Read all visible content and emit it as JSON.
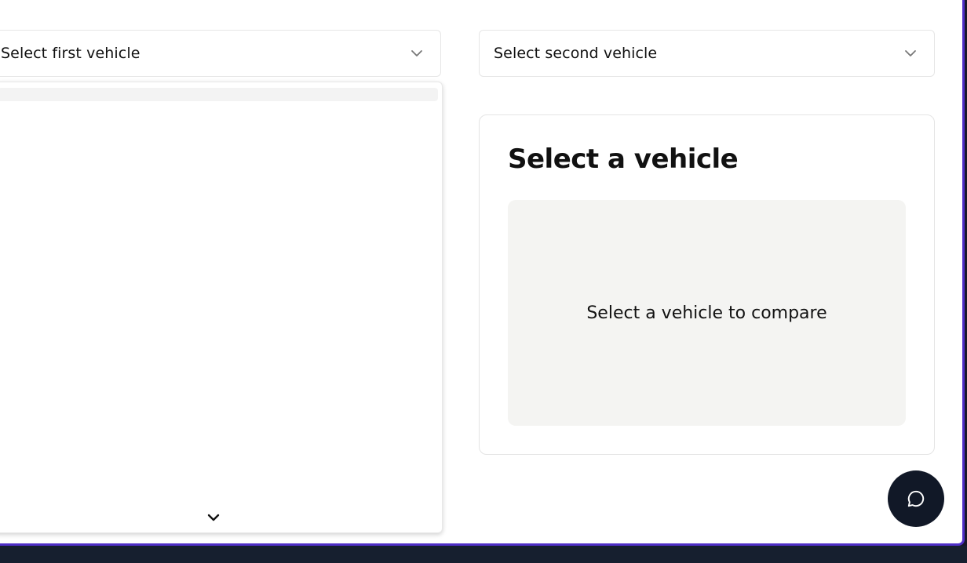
{
  "selectors": {
    "first": {
      "label": "Select first vehicle",
      "icon": "chevron-down-icon"
    },
    "second": {
      "label": "Select second vehicle",
      "icon": "chevron-down-icon"
    }
  },
  "dropdown": {
    "open": true,
    "scroll_icon": "chevron-down-icon"
  },
  "comparison_card": {
    "title": "Select a vehicle",
    "placeholder_text": "Select a vehicle to compare"
  },
  "chat": {
    "icon": "chat-bubble-icon"
  },
  "colors": {
    "accent_border": "#4f2fc7",
    "chat_button": "#111827",
    "placeholder_bg": "#f4f4f2",
    "bottom_bar": "#161f2f"
  }
}
